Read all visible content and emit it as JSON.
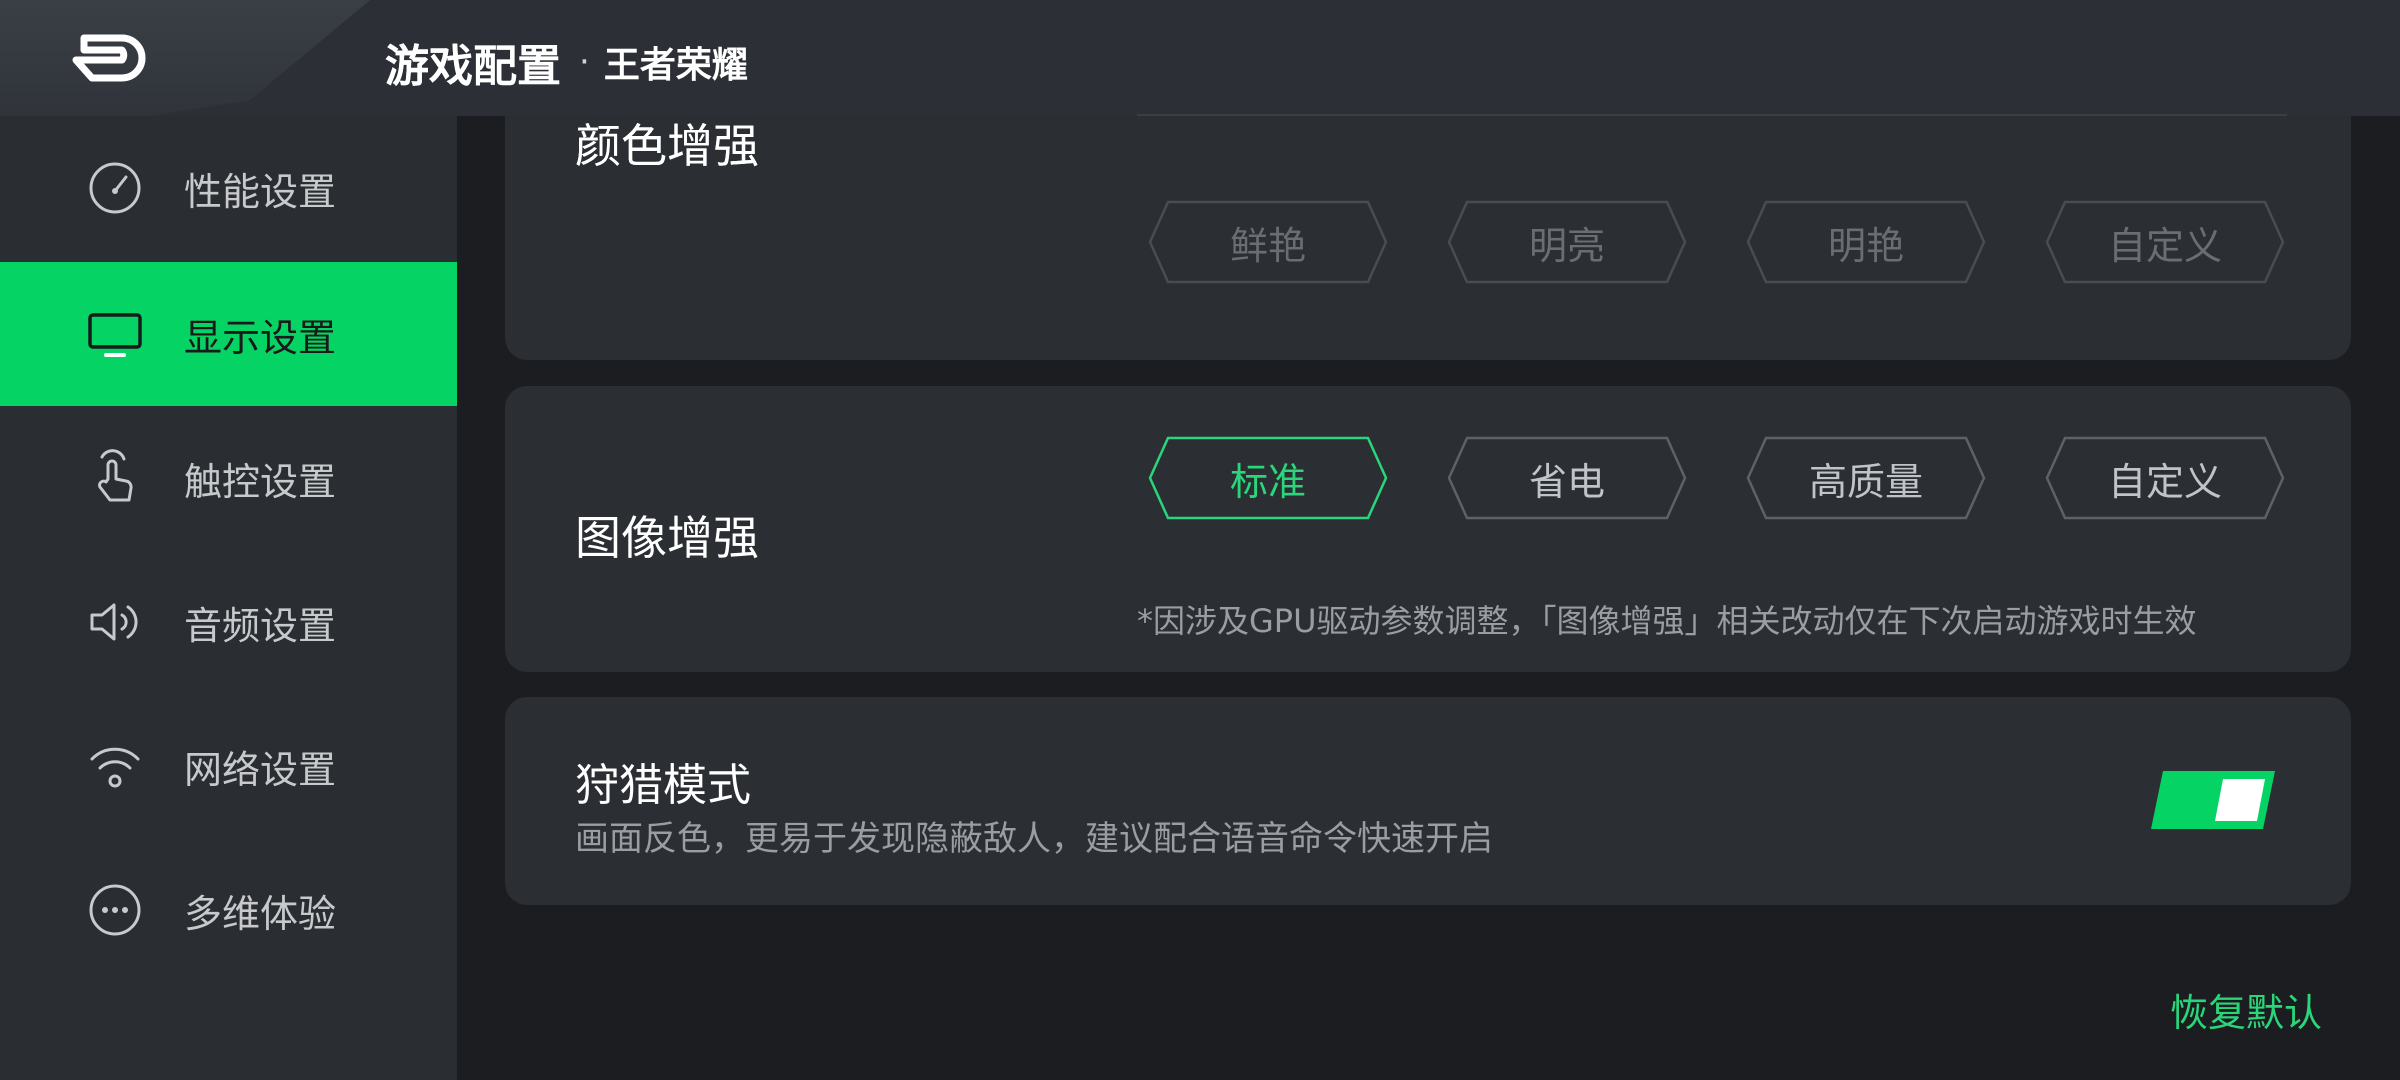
{
  "header": {
    "title": "游戏配置",
    "separator": "·",
    "game": "王者荣耀"
  },
  "sidebar": {
    "items": [
      {
        "label": "性能设置",
        "icon": "speedometer-icon"
      },
      {
        "label": "显示设置",
        "icon": "monitor-icon",
        "active": true
      },
      {
        "label": "触控设置",
        "icon": "touch-hand-icon"
      },
      {
        "label": "音频设置",
        "icon": "speaker-icon"
      },
      {
        "label": "网络设置",
        "icon": "wifi-icon"
      },
      {
        "label": "多维体验",
        "icon": "more-dots-icon"
      }
    ]
  },
  "color_enhance": {
    "title": "颜色增强",
    "options": [
      "鲜艳",
      "明亮",
      "明艳",
      "自定义"
    ],
    "enabled": false
  },
  "image_enhance": {
    "title": "图像增强",
    "options": [
      "标准",
      "省电",
      "高质量",
      "自定义"
    ],
    "selected": "标准",
    "note": "*因涉及GPU驱动参数调整，「图像增强」相关改动仅在下次启动游戏时生效"
  },
  "hunting_mode": {
    "title": "狩猎模式",
    "description": "画面反色，更易于发现隐蔽敌人，建议配合语音命令快速开启",
    "enabled": true
  },
  "footer": {
    "restore_label": "恢复默认"
  },
  "colors": {
    "accent": "#05d465",
    "background": "#1b1d20",
    "card": "#2b2e32"
  }
}
